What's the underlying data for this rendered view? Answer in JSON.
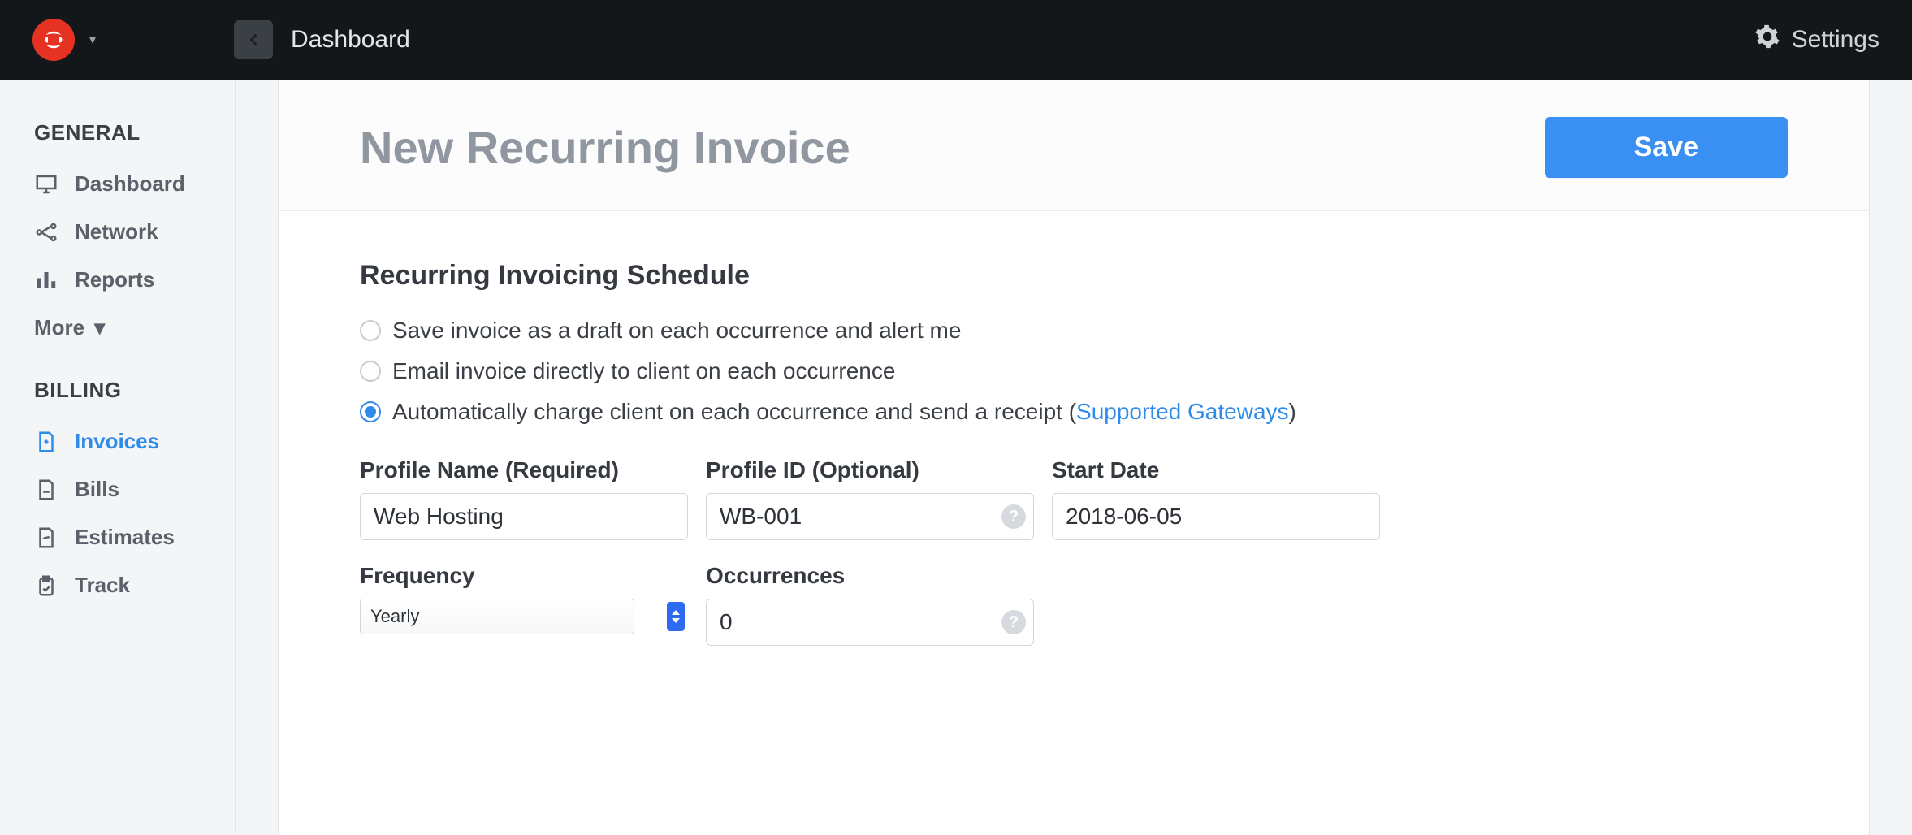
{
  "topbar": {
    "breadcrumb": "Dashboard",
    "settings_label": "Settings"
  },
  "sidebar": {
    "sections": {
      "general": {
        "label": "GENERAL",
        "items": [
          {
            "label": "Dashboard"
          },
          {
            "label": "Network"
          },
          {
            "label": "Reports"
          }
        ],
        "more_label": "More"
      },
      "billing": {
        "label": "BILLING",
        "items": [
          {
            "label": "Invoices"
          },
          {
            "label": "Bills"
          },
          {
            "label": "Estimates"
          },
          {
            "label": "Track"
          }
        ]
      }
    }
  },
  "page": {
    "title": "New Recurring Invoice",
    "save_label": "Save"
  },
  "form": {
    "section_heading": "Recurring Invoicing Schedule",
    "radios": {
      "draft": "Save invoice as a draft on each occurrence and alert me",
      "email": "Email invoice directly to client on each occurrence",
      "charge_prefix": "Automatically charge client on each occurrence and send a receipt ",
      "charge_link": "Supported Gateways",
      "charge_suffix": ""
    },
    "labels": {
      "profile_name": "Profile Name (Required)",
      "profile_id": "Profile ID (Optional)",
      "start_date": "Start Date",
      "frequency": "Frequency",
      "occurrences": "Occurrences"
    },
    "values": {
      "profile_name": "Web Hosting",
      "profile_id": "WB-001",
      "start_date": "2018-06-05",
      "frequency": "Yearly",
      "occurrences": "0"
    }
  }
}
